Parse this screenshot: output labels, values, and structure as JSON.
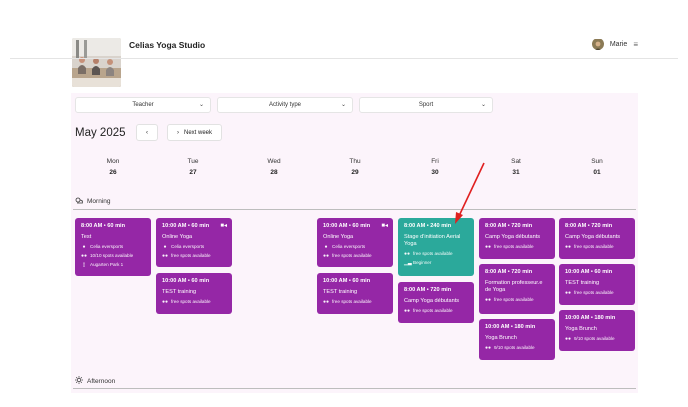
{
  "header": {
    "studio_name": "Celias Yoga Studio",
    "user_name": "Marie",
    "menu_icon": "hamburger-menu-icon"
  },
  "filters": [
    {
      "label": "Teacher"
    },
    {
      "label": "Activity type"
    },
    {
      "label": "Sport"
    }
  ],
  "calendar": {
    "month": "May 2025",
    "prev_label": "‹",
    "next_label": "Next week",
    "days": [
      {
        "name": "Mon",
        "date": "26"
      },
      {
        "name": "Tue",
        "date": "27"
      },
      {
        "name": "Wed",
        "date": "28"
      },
      {
        "name": "Thu",
        "date": "29"
      },
      {
        "name": "Fri",
        "date": "30"
      },
      {
        "name": "Sat",
        "date": "31"
      },
      {
        "name": "Sun",
        "date": "01"
      }
    ]
  },
  "sections": {
    "morning": "Morning",
    "afternoon": "Afternoon"
  },
  "events": {
    "mon_1": {
      "time": "8:00 AM • 60 min",
      "name": "Test",
      "teacher": "Celia eversports",
      "spots": "10/10 spots available",
      "location": "Augarten Park 1"
    },
    "tue_1": {
      "time": "10:00 AM • 60 min",
      "name": "Online Yoga",
      "teacher": "Celia eversports",
      "spots": "free spots available"
    },
    "tue_2": {
      "time": "10:00 AM • 60 min",
      "name": "TEST training",
      "spots": "free spots available"
    },
    "thu_1": {
      "time": "10:00 AM • 60 min",
      "name": "Online Yoga",
      "teacher": "Celia eversports",
      "spots": "free spots available"
    },
    "thu_2": {
      "time": "10:00 AM • 60 min",
      "name": "TEST training",
      "spots": "free spots available"
    },
    "fri_1": {
      "time": "8:00 AM • 240 min",
      "name": "Stage d'initiation Aerial Yoga",
      "spots": "free spots available",
      "level": "Beginner"
    },
    "fri_2": {
      "time": "8:00 AM • 720 min",
      "name": "Camp Yoga débutants",
      "spots": "free spots available"
    },
    "sat_1": {
      "time": "8:00 AM • 720 min",
      "name": "Camp Yoga débutants",
      "spots": "free spots available"
    },
    "sat_2": {
      "time": "8:00 AM • 720 min",
      "name": "Formation professeur.e de Yoga",
      "spots": "free spots available"
    },
    "sat_3": {
      "time": "10:00 AM • 180 min",
      "name": "Yoga Brunch",
      "spots": "9/10 spots available"
    },
    "sun_1": {
      "time": "8:00 AM • 720 min",
      "name": "Camp Yoga débutants",
      "spots": "free spots available"
    },
    "sun_2": {
      "time": "10:00 AM • 60 min",
      "name": "TEST training",
      "spots": "free spots available"
    },
    "sun_3": {
      "time": "10:00 AM • 180 min",
      "name": "Yoga Brunch",
      "spots": "9/10 spots available"
    }
  },
  "colors": {
    "event_purple": "#9527a6",
    "event_teal": "#2ba99b",
    "panel_bg": "#fcf4fb",
    "annotation_arrow": "#e02020"
  }
}
